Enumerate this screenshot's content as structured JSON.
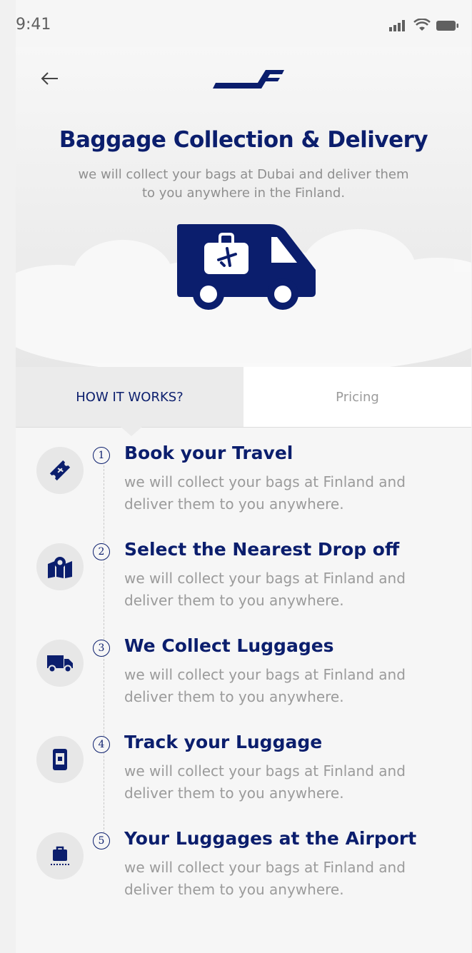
{
  "status_bar": {
    "time": "9:41"
  },
  "header": {
    "title": "Baggage Collection & Delivery",
    "subtitle": "we will collect your bags at Dubai and deliver them to you anywhere in the Finland."
  },
  "tabs": [
    {
      "label": "HOW IT WORKS?",
      "active": true
    },
    {
      "label": "Pricing",
      "active": false
    }
  ],
  "steps": [
    {
      "number": "1",
      "icon": "ticket-icon",
      "title": "Book your Travel",
      "description": "we will collect your bags at Finland and deliver them to you anywhere."
    },
    {
      "number": "2",
      "icon": "map-pin-icon",
      "title": "Select the Nearest Drop off",
      "description": "we will collect your bags at Finland and deliver them to you anywhere."
    },
    {
      "number": "3",
      "icon": "truck-icon",
      "title": "We Collect Luggages",
      "description": "we will collect your bags at Finland and deliver them to you anywhere."
    },
    {
      "number": "4",
      "icon": "phone-icon",
      "title": "Track your Luggage",
      "description": "we will collect your bags at Finland and deliver them to you anywhere."
    },
    {
      "number": "5",
      "icon": "luggage-cart-icon",
      "title": "Your Luggages at the Airport",
      "description": "we will collect your bags at Finland and deliver them to you anywhere."
    }
  ],
  "colors": {
    "brand": "#0b1e6d",
    "muted": "#9b9b9b",
    "background": "#f6f6f6"
  }
}
